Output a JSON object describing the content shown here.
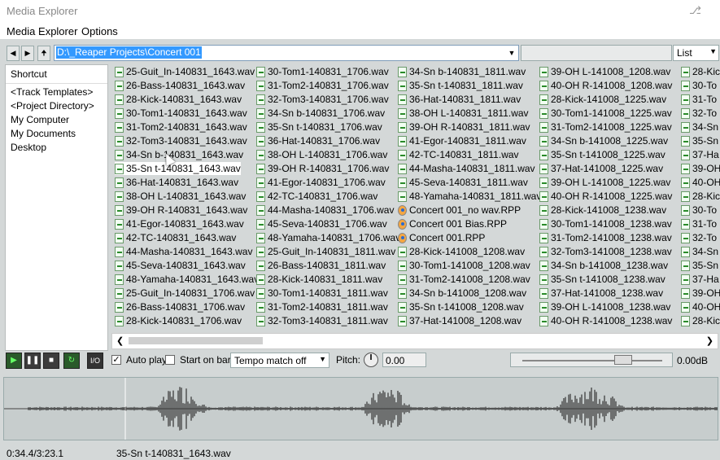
{
  "window": {
    "title": "Media Explorer"
  },
  "menu": [
    "Media Explorer",
    "Options"
  ],
  "toolbar": {
    "path": "D:\\_Reaper Projects\\Concert 001",
    "view_mode": "List"
  },
  "sidebar": {
    "items": [
      "Shortcut",
      "<Track Templates>",
      "<Project Directory>",
      "My Computer",
      "My Documents",
      "Desktop"
    ]
  },
  "files": {
    "selected": "35-Sn t-140831_1643.wav",
    "columns": [
      [
        "25-Guit_In-140831_1643.wav",
        "26-Bass-140831_1643.wav",
        "28-Kick-140831_1643.wav",
        "30-Tom1-140831_1643.wav",
        "31-Tom2-140831_1643.wav",
        "32-Tom3-140831_1643.wav",
        "34-Sn b-140831_1643.wav",
        "35-Sn t-140831_1643.wav",
        "36-Hat-140831_1643.wav",
        "38-OH L-140831_1643.wav",
        "39-OH R-140831_1643.wav",
        "41-Egor-140831_1643.wav",
        "42-TC-140831_1643.wav",
        "44-Masha-140831_1643.wav",
        "45-Seva-140831_1643.wav",
        "48-Yamaha-140831_1643.wav",
        "25-Guit_In-140831_1706.wav",
        "26-Bass-140831_1706.wav",
        "28-Kick-140831_1706.wav"
      ],
      [
        "30-Tom1-140831_1706.wav",
        "31-Tom2-140831_1706.wav",
        "32-Tom3-140831_1706.wav",
        "34-Sn b-140831_1706.wav",
        "35-Sn t-140831_1706.wav",
        "36-Hat-140831_1706.wav",
        "38-OH L-140831_1706.wav",
        "39-OH R-140831_1706.wav",
        "41-Egor-140831_1706.wav",
        "42-TC-140831_1706.wav",
        "44-Masha-140831_1706.wav",
        "45-Seva-140831_1706.wav",
        "48-Yamaha-140831_1706.wav",
        "25-Guit_In-140831_1811.wav",
        "26-Bass-140831_1811.wav",
        "28-Kick-140831_1811.wav",
        "30-Tom1-140831_1811.wav",
        "31-Tom2-140831_1811.wav",
        "32-Tom3-140831_1811.wav"
      ],
      [
        "34-Sn b-140831_1811.wav",
        "35-Sn t-140831_1811.wav",
        "36-Hat-140831_1811.wav",
        "38-OH L-140831_1811.wav",
        "39-OH R-140831_1811.wav",
        "41-Egor-140831_1811.wav",
        "42-TC-140831_1811.wav",
        "44-Masha-140831_1811.wav",
        "45-Seva-140831_1811.wav",
        "48-Yamaha-140831_1811.wav",
        "Concert 001_no wav.RPP",
        "Concert 001 Bias.RPP",
        "Concert 001.RPP",
        "28-Kick-141008_1208.wav",
        "30-Tom1-141008_1208.wav",
        "31-Tom2-141008_1208.wav",
        "34-Sn b-141008_1208.wav",
        "35-Sn t-141008_1208.wav",
        "37-Hat-141008_1208.wav"
      ],
      [
        "39-OH L-141008_1208.wav",
        "40-OH R-141008_1208.wav",
        "28-Kick-141008_1225.wav",
        "30-Tom1-141008_1225.wav",
        "31-Tom2-141008_1225.wav",
        "34-Sn b-141008_1225.wav",
        "35-Sn t-141008_1225.wav",
        "37-Hat-141008_1225.wav",
        "39-OH L-141008_1225.wav",
        "40-OH R-141008_1225.wav",
        "28-Kick-141008_1238.wav",
        "30-Tom1-141008_1238.wav",
        "31-Tom2-141008_1238.wav",
        "32-Tom3-141008_1238.wav",
        "34-Sn b-141008_1238.wav",
        "35-Sn t-141008_1238.wav",
        "37-Hat-141008_1238.wav",
        "39-OH L-141008_1238.wav",
        "40-OH R-141008_1238.wav"
      ],
      [
        "28-Kic",
        "30-To",
        "31-To",
        "32-To",
        "34-Sn",
        "35-Sn",
        "37-Ha",
        "39-OH",
        "40-OH",
        "28-Kic",
        "30-To",
        "31-To",
        "32-To",
        "34-Sn",
        "35-Sn",
        "37-Ha",
        "39-OH",
        "40-OH",
        "28-Kic"
      ]
    ]
  },
  "transport": {
    "io_label": "I/O",
    "autoplay_label": "Auto play",
    "autoplay_checked": true,
    "startonbar_label": "Start on bar",
    "startonbar_checked": false,
    "tempo_mode": "Tempo match off",
    "pitch_label": "Pitch:",
    "pitch_value": "0.00",
    "volume_db": "0.00dB",
    "volume_fraction": 0.72
  },
  "status": {
    "position": "0:34.4/3:23.1",
    "current_file": "35-Sn t-140831_1643.wav"
  },
  "colors": {
    "selection": "#3399ff",
    "play_green": "#2a5a2a",
    "waveform": "#333333"
  }
}
